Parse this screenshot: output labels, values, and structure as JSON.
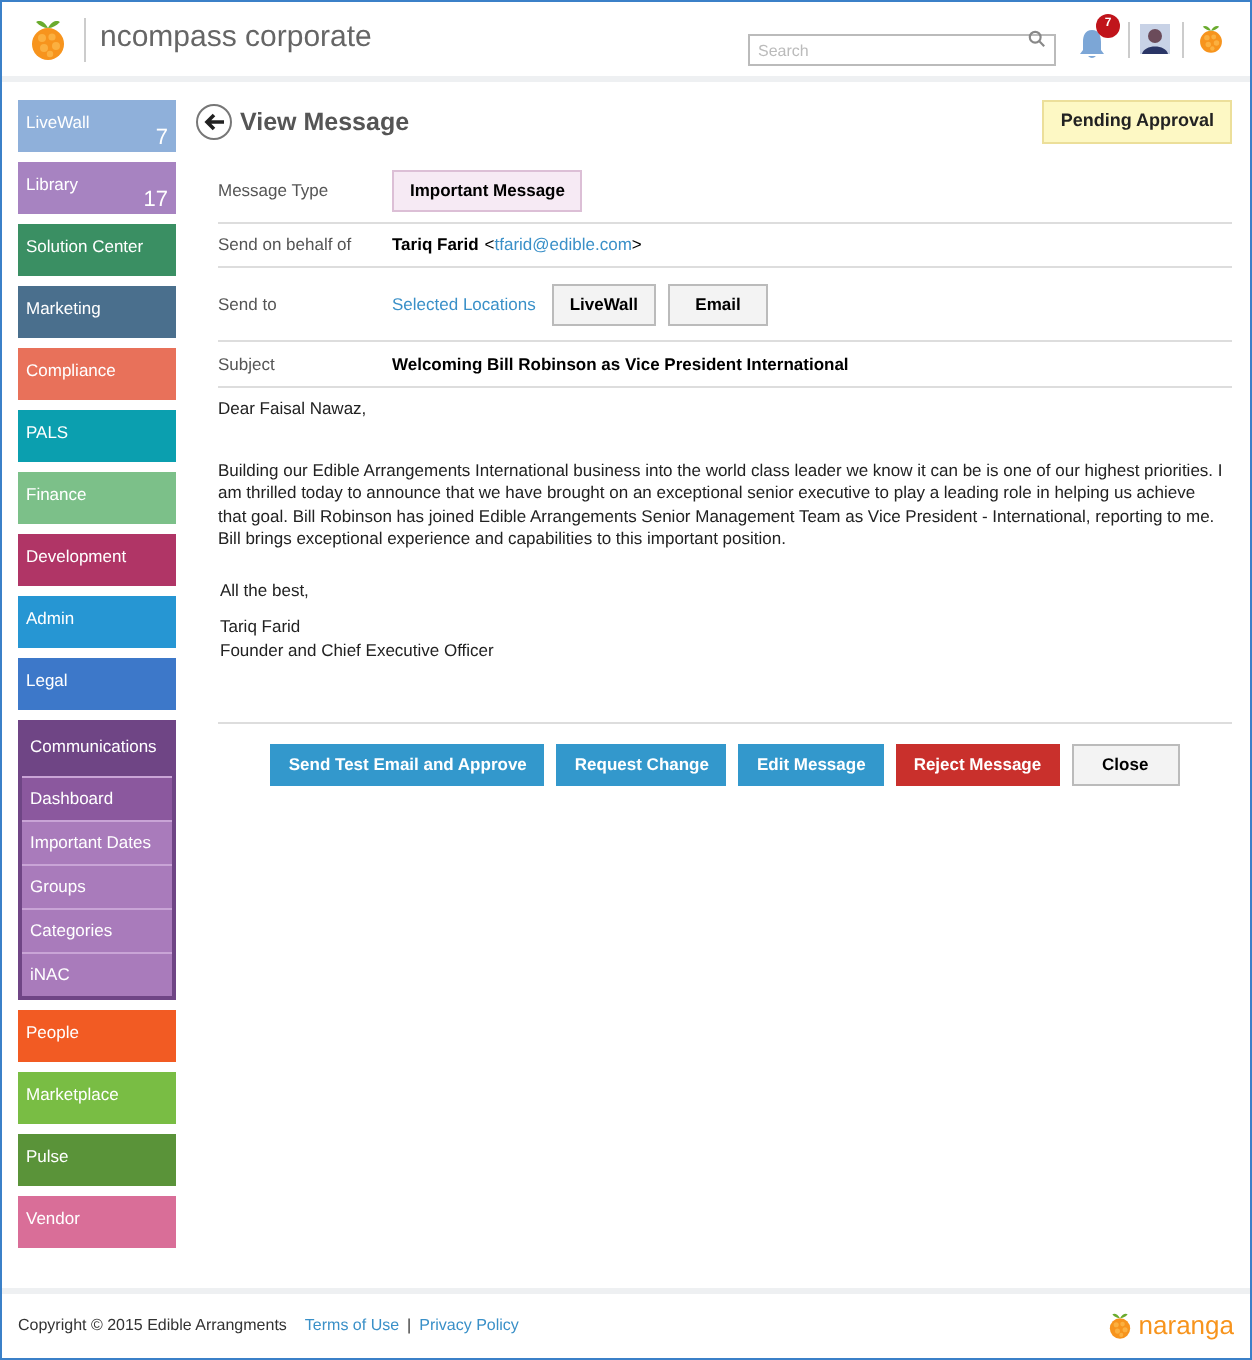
{
  "header": {
    "brand": "ncompass corporate",
    "search": {
      "placeholder": "Search"
    },
    "notifications": "7"
  },
  "sidebar": {
    "items": [
      {
        "label": "LiveWall",
        "count": "7",
        "color": "#8fb0da",
        "expanded": false
      },
      {
        "label": "Library",
        "count": "17",
        "color": "#a783c1",
        "expanded": false
      },
      {
        "label": "Solution Center",
        "color": "#3a8f63",
        "expanded": false
      },
      {
        "label": "Marketing",
        "color": "#4a6f8d",
        "expanded": false
      },
      {
        "label": "Compliance",
        "color": "#e8715a",
        "expanded": false
      },
      {
        "label": "PALS",
        "color": "#0b9faf",
        "expanded": false
      },
      {
        "label": "Finance",
        "color": "#7cc089",
        "expanded": false
      },
      {
        "label": "Development",
        "color": "#b03566",
        "expanded": false
      },
      {
        "label": "Admin",
        "color": "#2696d3",
        "expanded": false
      },
      {
        "label": "Legal",
        "color": "#3d78c9",
        "expanded": false
      },
      {
        "label": "Communications",
        "color": "#6f4585",
        "expanded": true,
        "children": [
          {
            "label": "Dashboard",
            "selected": true
          },
          {
            "label": "Important Dates",
            "selected": false
          },
          {
            "label": "Groups",
            "selected": false
          },
          {
            "label": "Categories",
            "selected": false
          },
          {
            "label": "iNAC",
            "selected": false
          }
        ]
      },
      {
        "label": "People",
        "color": "#f25b23",
        "expanded": false
      },
      {
        "label": "Marketplace",
        "color": "#79bd44",
        "expanded": false
      },
      {
        "label": "Pulse",
        "color": "#5a9339",
        "expanded": false
      },
      {
        "label": "Vendor",
        "color": "#d96e98",
        "expanded": false
      }
    ]
  },
  "page": {
    "title": "View Message",
    "status": "Pending Approval"
  },
  "fields": {
    "message_type": {
      "label": "Message Type",
      "value": "Important Message"
    },
    "behalf": {
      "label": "Send on behalf of",
      "name": "Tariq Farid",
      "email_open": "<",
      "email": "tfarid@edible.com",
      "email_close": ">"
    },
    "send_to": {
      "label": "Send to",
      "link": "Selected Locations",
      "channels": [
        "LiveWall",
        "Email"
      ]
    },
    "subject": {
      "label": "Subject",
      "value": "Welcoming Bill Robinson as Vice President International"
    }
  },
  "message": {
    "greeting": "Dear Faisal Nawaz,",
    "body": "Building our Edible Arrangements International business into the world class leader we know it can be is one of our highest priorities. I am thrilled today to announce that we have brought on an exceptional senior executive to play a leading role in helping us achieve that goal. Bill Robinson has joined Edible Arrangements Senior Management Team as Vice President - International, reporting to me. Bill brings exceptional experience and capabilities to this important position.",
    "closing": "All the best,",
    "signature_name": "Tariq Farid",
    "signature_title": "Founder and Chief Executive Officer"
  },
  "actions": [
    {
      "label": "Send Test Email and Approve",
      "kind": "primary"
    },
    {
      "label": "Request Change",
      "kind": "primary"
    },
    {
      "label": "Edit Message",
      "kind": "primary"
    },
    {
      "label": "Reject Message",
      "kind": "danger"
    },
    {
      "label": "Close",
      "kind": "default"
    }
  ],
  "footer": {
    "copyright": "Copyright © 2015 Edible Arrangments",
    "links": [
      "Terms of Use",
      "Privacy Policy"
    ],
    "separator": "|",
    "logo": "naranga"
  }
}
